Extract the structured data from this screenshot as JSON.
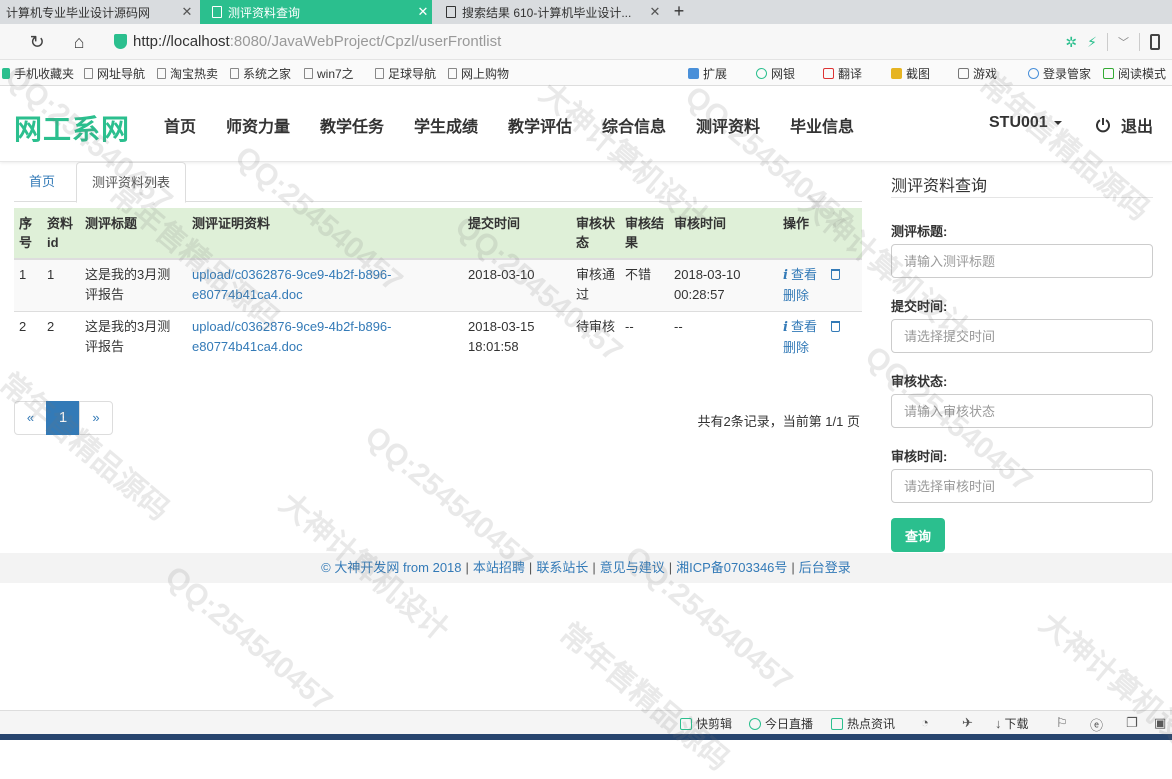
{
  "browser": {
    "tabs": [
      {
        "title": "计算机专业毕业设计源码网",
        "active": false
      },
      {
        "title": "测评资料查询",
        "active": true
      },
      {
        "title": "搜索结果 610-计算机毕业设计...",
        "active": false
      }
    ],
    "new_tab": "+",
    "url_host": "http://localhost",
    "url_path": ":8080/JavaWebProject/Cpzl/userFrontlist",
    "bookmarks": [
      "手机收藏夹",
      "网址导航",
      "淘宝热卖",
      "系统之家",
      "win7之",
      "足球导航",
      "网上购物"
    ],
    "toolbar_right": [
      "扩展",
      "网银",
      "翻译",
      "截图",
      "游戏",
      "登录管家",
      "阅读模式"
    ],
    "status_items": [
      "快剪辑",
      "今日直播",
      "热点资讯",
      "下载"
    ]
  },
  "site": {
    "brand": "网工系网",
    "menu": [
      "首页",
      "师资力量",
      "教学任务",
      "学生成绩",
      "教学评估",
      "综合信息",
      "测评资料",
      "毕业信息"
    ],
    "user": "STU001",
    "logout": "退出"
  },
  "content_tabs": {
    "home": "首页",
    "current": "测评资料列表"
  },
  "table": {
    "headers": {
      "seq": "序号",
      "id": "资料id",
      "title": "测评标题",
      "file": "测评证明资料",
      "submit_time": "提交时间",
      "status": "审核状态",
      "result": "审核结果",
      "review_time": "审核时间",
      "ops": "操作"
    },
    "rows": [
      {
        "seq": "1",
        "id": "1",
        "title": "这是我的3月测评报告",
        "file": "upload/c0362876-9ce9-4b2f-b896-e80774b41ca4.doc",
        "submit_time": "2018-03-10",
        "status": "审核通过",
        "result": "不错",
        "review_time": "2018-03-10 00:28:57",
        "view": "查看",
        "delete": "删除"
      },
      {
        "seq": "2",
        "id": "2",
        "title": "这是我的3月测评报告",
        "file": "upload/c0362876-9ce9-4b2f-b896-e80774b41ca4.doc",
        "submit_time": "2018-03-15 18:01:58",
        "status": "待审核",
        "result": "--",
        "review_time": "--",
        "view": "查看",
        "delete": "删除"
      }
    ]
  },
  "pager": {
    "prev": "«",
    "current": "1",
    "next": "»",
    "summary": "共有2条记录，当前第 1/1 页"
  },
  "search": {
    "title": "测评资料查询",
    "fields": [
      {
        "label": "测评标题:",
        "placeholder": "请输入测评标题"
      },
      {
        "label": "提交时间:",
        "placeholder": "请选择提交时间"
      },
      {
        "label": "审核状态:",
        "placeholder": "请输入审核状态"
      },
      {
        "label": "审核时间:",
        "placeholder": "请选择审核时间"
      }
    ],
    "button": "查询"
  },
  "footer": {
    "links": [
      "© 大神开发网 from 2018",
      "本站招聘",
      "联系站长",
      "意见与建议",
      "湘ICP备0703346号",
      "后台登录"
    ],
    "separator": "|"
  },
  "watermark": {
    "texts": [
      "QQ:254540457",
      "大神计算机设计",
      "常年售精品源码"
    ]
  },
  "colors": {
    "accent": "#2bbf8e",
    "link": "#337ab7",
    "header_row": "#dff0d8"
  }
}
